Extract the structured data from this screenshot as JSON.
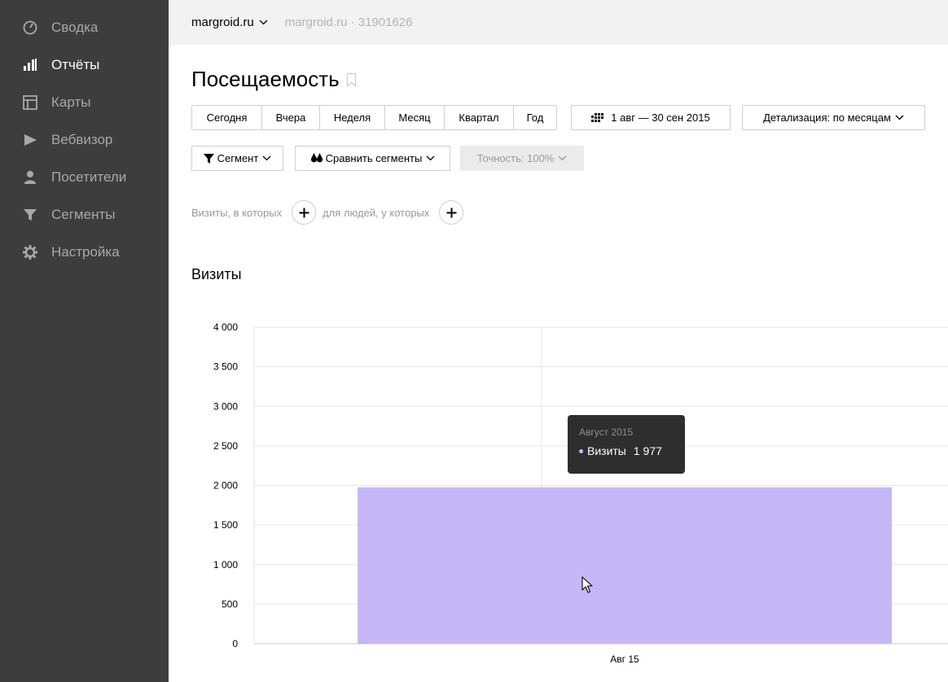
{
  "sidebar": {
    "items": [
      {
        "label": "Сводка",
        "icon": "gauge-icon",
        "active": false
      },
      {
        "label": "Отчёты",
        "icon": "bar-chart-icon",
        "active": true
      },
      {
        "label": "Карты",
        "icon": "map-icon",
        "active": false
      },
      {
        "label": "Вебвизор",
        "icon": "play-icon",
        "active": false
      },
      {
        "label": "Посетители",
        "icon": "user-icon",
        "active": false
      },
      {
        "label": "Сегменты",
        "icon": "funnel-icon",
        "active": false
      },
      {
        "label": "Настройка",
        "icon": "gear-icon",
        "active": false
      }
    ]
  },
  "topbar": {
    "site": "margroid.ru",
    "counter": "margroid.ru · 31901626"
  },
  "report": {
    "title": "Посещаемость"
  },
  "period": {
    "buttons": [
      "Сегодня",
      "Вчера",
      "Неделя",
      "Месяц",
      "Квартал",
      "Год"
    ],
    "date_range": "1 авг — 30 сен 2015",
    "detail": "Детализация: по месяцам"
  },
  "filters": {
    "segment": "Сегмент",
    "compare": "Сравнить сегменты",
    "accuracy": "Точность: 100%"
  },
  "conditions": {
    "visits_label": "Визиты, в которых",
    "people_label": "для людей, у которых"
  },
  "chart_section": {
    "title": "Визиты"
  },
  "chart_data": {
    "type": "bar",
    "categories": [
      "Авг 15"
    ],
    "series": [
      {
        "name": "Визиты",
        "values": [
          1977
        ]
      }
    ],
    "ylim": [
      0,
      4000
    ],
    "yticks": [
      "0",
      "500",
      "1 000",
      "1 500",
      "2 000",
      "2 500",
      "3 000",
      "3 500",
      "4 000"
    ],
    "bar_color": "#c7b6f6",
    "grid": true
  },
  "tooltip": {
    "month": "Август 2015",
    "series": "Визиты",
    "value": "1 977"
  }
}
